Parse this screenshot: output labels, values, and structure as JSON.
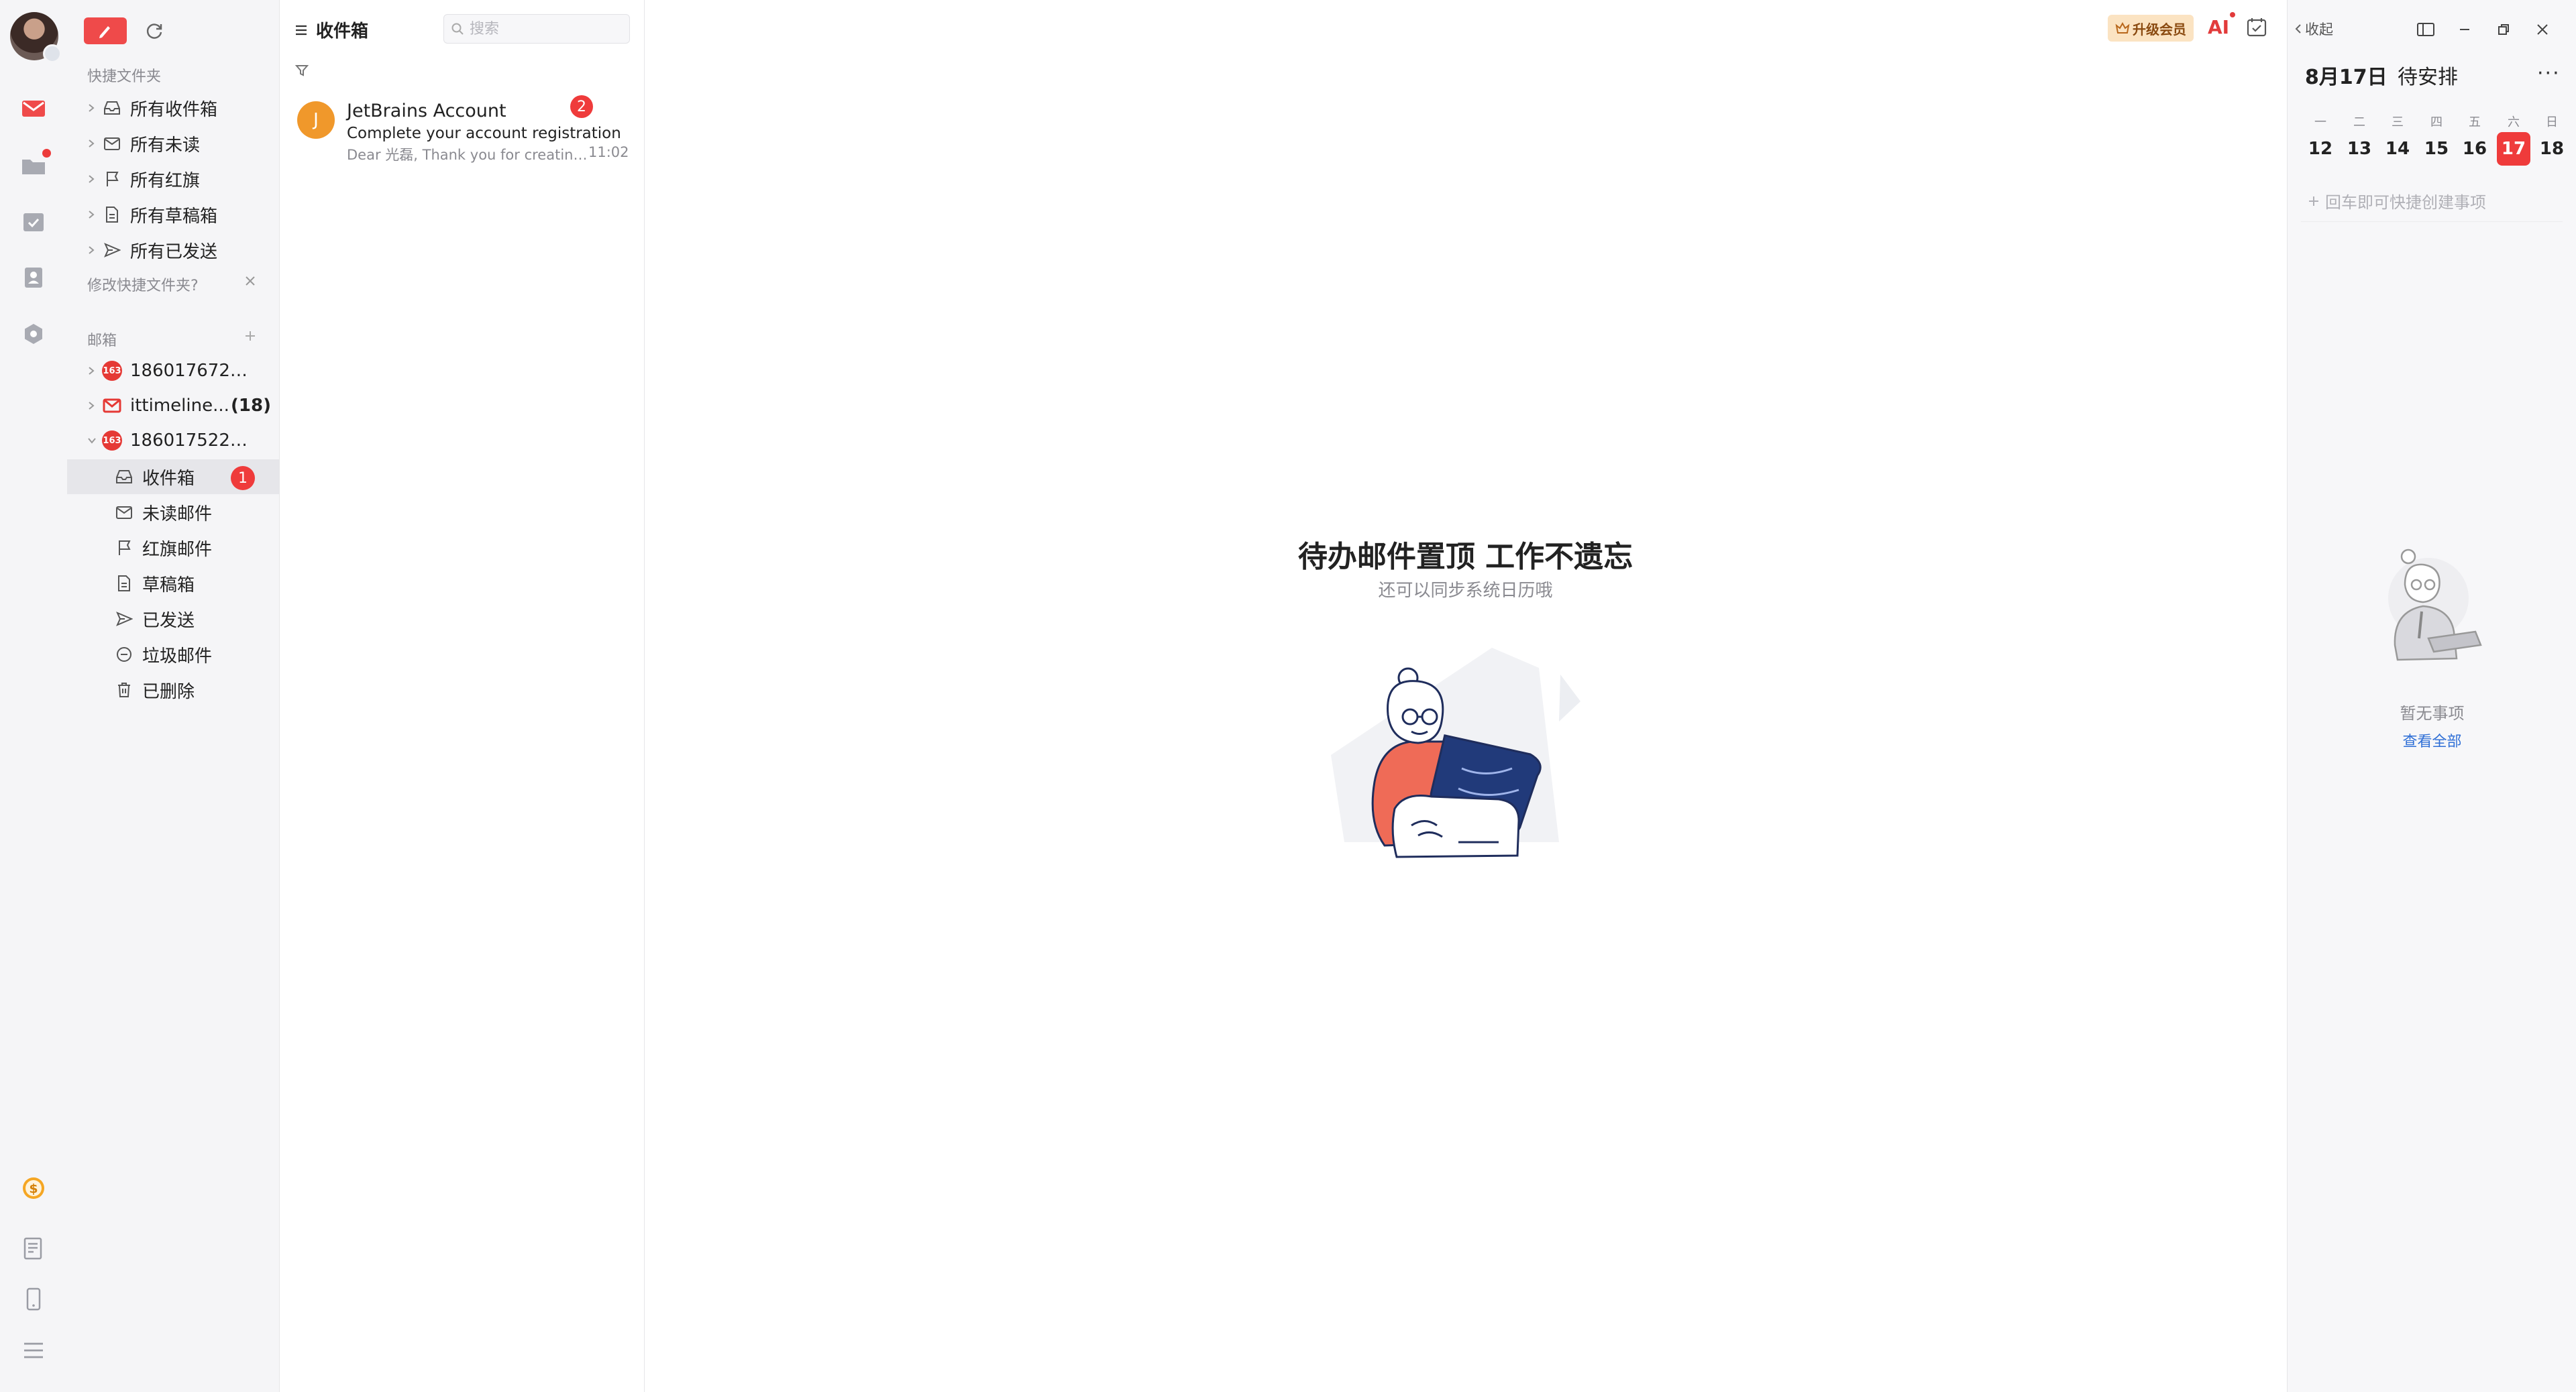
{
  "colors": {
    "accent": "#ef4a4a",
    "badge": "#ef3b3b",
    "link": "#2f6fd6",
    "avatar_j": "#f0982b",
    "upgrade_bg": "#fbe3c2"
  },
  "rail": {
    "icons": [
      "mail-icon",
      "folder-icon",
      "calendar-check-icon",
      "contacts-icon",
      "plugin-icon",
      "dollar-icon",
      "notes-icon",
      "phone-icon",
      "menu-icon"
    ]
  },
  "sidebar": {
    "quick_title": "快捷文件夹",
    "quick_items": [
      {
        "label": "所有收件箱",
        "icon": "inbox-icon"
      },
      {
        "label": "所有未读",
        "icon": "unread-icon"
      },
      {
        "label": "所有红旗",
        "icon": "flag-icon"
      },
      {
        "label": "所有草稿箱",
        "icon": "draft-icon"
      },
      {
        "label": "所有已发送",
        "icon": "sent-icon"
      }
    ],
    "edit_quick": "修改快捷文件夹?",
    "mailbox_title": "邮箱",
    "accounts": [
      {
        "label": "18601767221...",
        "icon": "163-logo"
      },
      {
        "label": "ittimeline...",
        "count": "(18)",
        "icon": "gmail-icon"
      },
      {
        "label": "18601752216...",
        "icon": "163-logo"
      }
    ],
    "folders": [
      {
        "label": "收件箱",
        "badge": "1",
        "icon": "inbox-icon"
      },
      {
        "label": "未读邮件",
        "icon": "unread-icon"
      },
      {
        "label": "红旗邮件",
        "icon": "flag-icon"
      },
      {
        "label": "草稿箱",
        "icon": "draft-icon"
      },
      {
        "label": "已发送",
        "icon": "sent-icon"
      },
      {
        "label": "垃圾邮件",
        "icon": "spam-icon"
      },
      {
        "label": "已删除",
        "icon": "trash-icon"
      }
    ]
  },
  "list": {
    "title": "收件箱",
    "search_placeholder": "搜索",
    "mail": {
      "avatar": "J",
      "sender": "JetBrains Account",
      "subject": "Complete your account registration",
      "preview": "Dear 光磊, Thank you for creating ...",
      "time": "11:02",
      "badge": "2"
    }
  },
  "main": {
    "empty_title": "待办邮件置顶 工作不遗忘",
    "empty_sub": "还可以同步系统日历哦",
    "upgrade": "升级会员",
    "ai": "AI"
  },
  "panel": {
    "collapse": "收起",
    "date": "8月17日",
    "agenda": "待安排",
    "more": "···",
    "weekdays": [
      "一",
      "二",
      "三",
      "四",
      "五",
      "六",
      "日"
    ],
    "days": [
      "12",
      "13",
      "14",
      "15",
      "16",
      "17",
      "18"
    ],
    "today_index": 5,
    "quick_add": "回车即可快捷创建事项",
    "no_items": "暂无事项",
    "view_all": "查看全部"
  }
}
